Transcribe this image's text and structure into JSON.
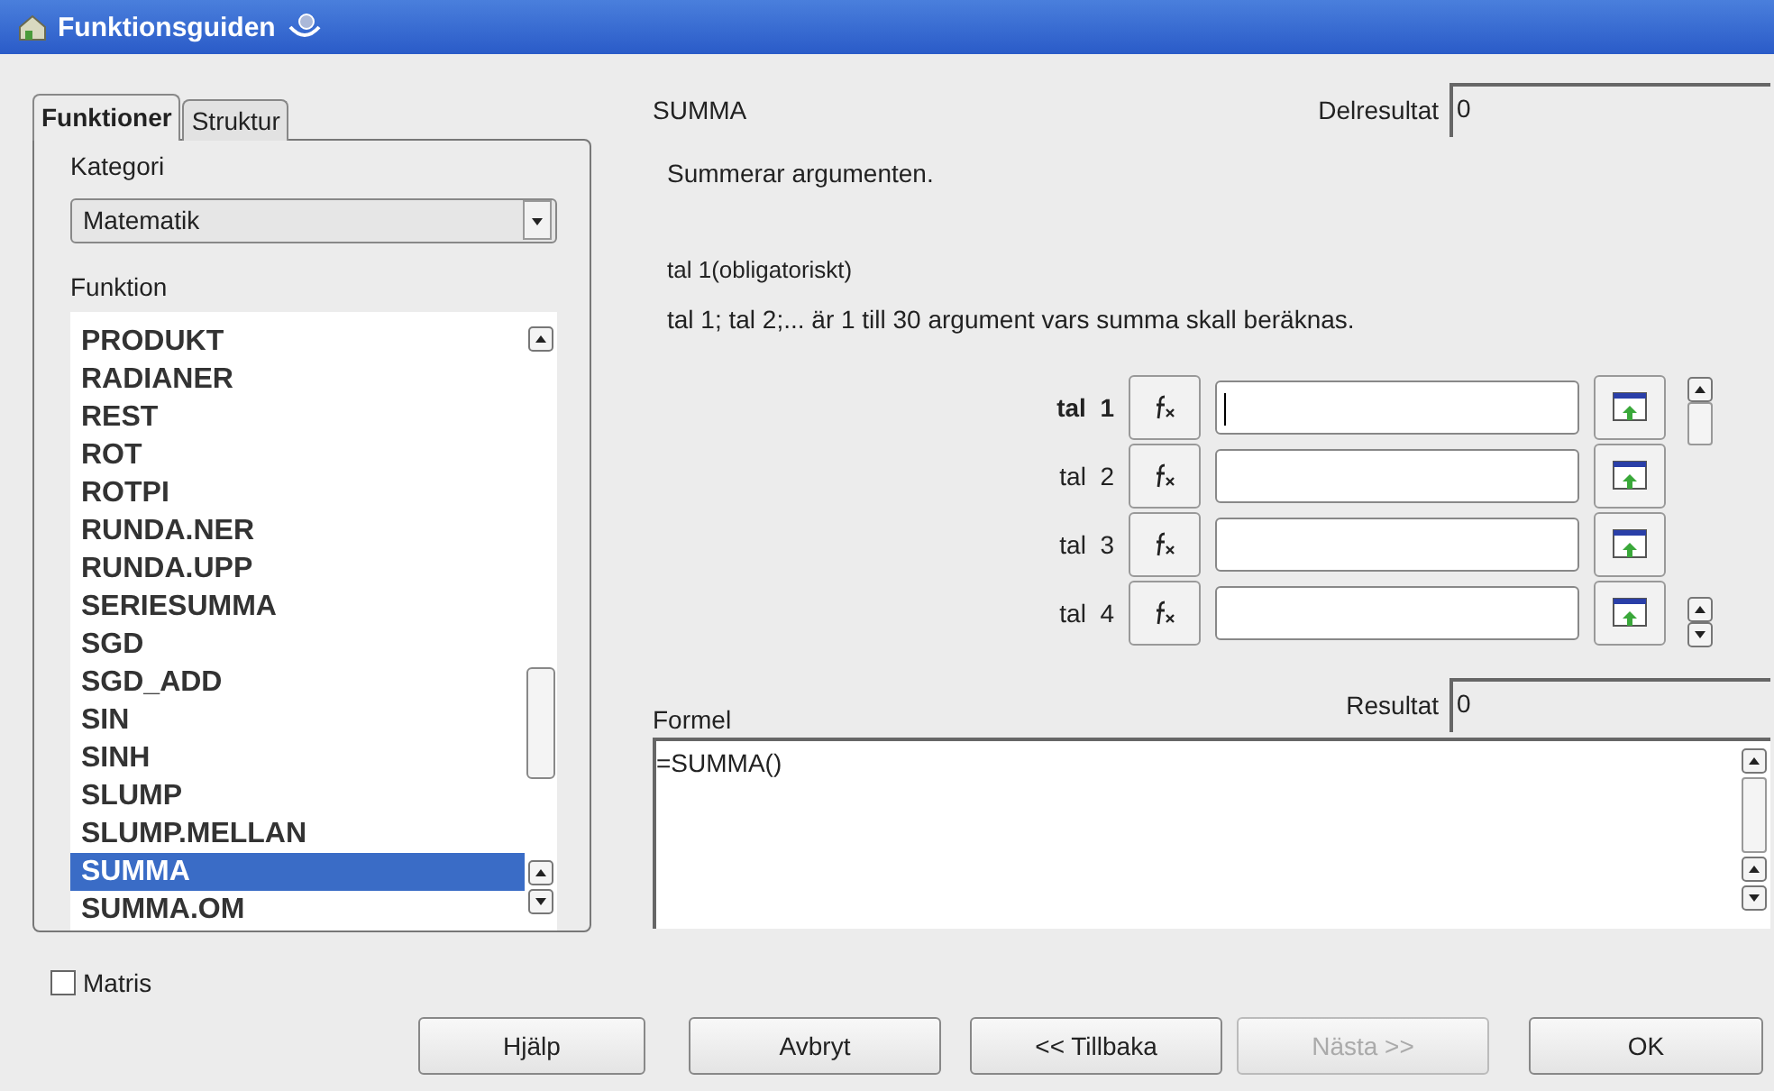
{
  "window": {
    "title": "Funktionsguiden"
  },
  "tabs": [
    {
      "label": "Funktioner",
      "selected": true
    },
    {
      "label": "Struktur",
      "selected": false
    }
  ],
  "category": {
    "label": "Kategori",
    "value": "Matematik"
  },
  "function_list": {
    "label": "Funktion",
    "items": [
      {
        "name": "PRODUKT",
        "selected": false
      },
      {
        "name": "RADIANER",
        "selected": false
      },
      {
        "name": "REST",
        "selected": false
      },
      {
        "name": "ROT",
        "selected": false
      },
      {
        "name": "ROTPI",
        "selected": false
      },
      {
        "name": "RUNDA.NER",
        "selected": false
      },
      {
        "name": "RUNDA.UPP",
        "selected": false
      },
      {
        "name": "SERIESUMMA",
        "selected": false
      },
      {
        "name": "SGD",
        "selected": false
      },
      {
        "name": "SGD_ADD",
        "selected": false
      },
      {
        "name": "SIN",
        "selected": false
      },
      {
        "name": "SINH",
        "selected": false
      },
      {
        "name": "SLUMP",
        "selected": false
      },
      {
        "name": "SLUMP.MELLAN",
        "selected": false
      },
      {
        "name": "SUMMA",
        "selected": true
      },
      {
        "name": "SUMMA.OM",
        "selected": false
      }
    ]
  },
  "function_name": "SUMMA",
  "partial_result": {
    "label": "Delresultat",
    "value": "0"
  },
  "description": "Summerar argumenten.",
  "argument_title": "tal  1(obligatoriskt)",
  "argument_description": "tal 1; tal 2;... är 1 till 30 argument vars summa skall beräknas.",
  "arguments": [
    {
      "label": "tal  1",
      "selected": true
    },
    {
      "label": "tal  2",
      "selected": false
    },
    {
      "label": "tal  3",
      "selected": false
    },
    {
      "label": "tal  4",
      "selected": false
    }
  ],
  "formula": {
    "label": "Formel",
    "value": "=SUMMA()"
  },
  "result": {
    "label": "Resultat",
    "value": "0"
  },
  "matrix": {
    "label": "Matris",
    "checked": false
  },
  "buttons": [
    {
      "label": "Hjälp",
      "disabled": false
    },
    {
      "label": "Avbryt",
      "disabled": false
    },
    {
      "label": "<< Tillbaka",
      "disabled": false
    },
    {
      "label": "Nästa >>",
      "disabled": true
    },
    {
      "label": "OK",
      "disabled": false
    }
  ]
}
